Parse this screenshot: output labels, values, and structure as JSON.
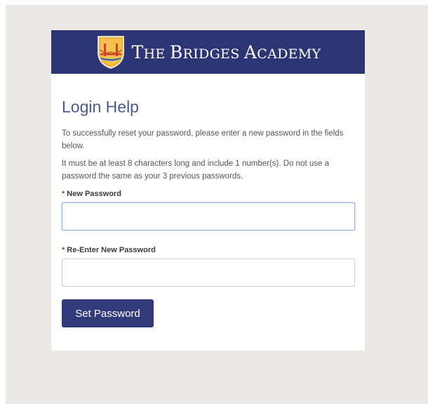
{
  "header": {
    "brand_first": "T",
    "brand_rest": "HE ",
    "brand_b": "B",
    "brand_ridges": "RIDGES ",
    "brand_a": "A",
    "brand_cademy": "CADEMY",
    "colors": {
      "header_bg": "#2e3575",
      "crest_gold": "#f0b23a",
      "crest_red": "#d1422e"
    }
  },
  "form": {
    "title": "Login Help",
    "instructions": "To successfully reset your password, please enter a new password in the fields below.",
    "requirements": "It must be at least 8 characters long and include 1 number(s). Do not use a password the same as your 3 previous passwords.",
    "required_marker": "*",
    "new_password": {
      "label": "New Password",
      "value": "",
      "placeholder": ""
    },
    "reenter_password": {
      "label": "Re-Enter New Password",
      "value": "",
      "placeholder": ""
    },
    "submit_label": "Set Password",
    "colors": {
      "title": "#4c5a8c",
      "button_bg": "#323a7a",
      "focus_border": "#8ab1e0",
      "required": "#c23934"
    }
  }
}
